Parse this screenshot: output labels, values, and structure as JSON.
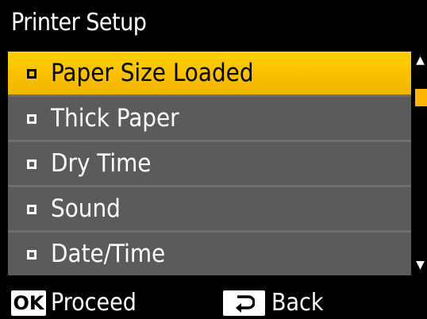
{
  "header": {
    "title": "Printer Setup"
  },
  "menu": {
    "items": [
      {
        "label": "Paper Size Loaded",
        "selected": true
      },
      {
        "label": "Thick Paper",
        "selected": false
      },
      {
        "label": "Dry Time",
        "selected": false
      },
      {
        "label": "Sound",
        "selected": false
      },
      {
        "label": "Date/Time",
        "selected": false
      }
    ]
  },
  "footer": {
    "ok_key": "OK",
    "ok_label": "Proceed",
    "back_label": "Back"
  },
  "icons": {
    "scroll_up": "triangle-up",
    "scroll_down": "triangle-down",
    "back_key": "return-arrow"
  },
  "colors": {
    "highlight": "#ffc400",
    "item_background": "#5b5b5b",
    "screen_background": "#000000"
  }
}
